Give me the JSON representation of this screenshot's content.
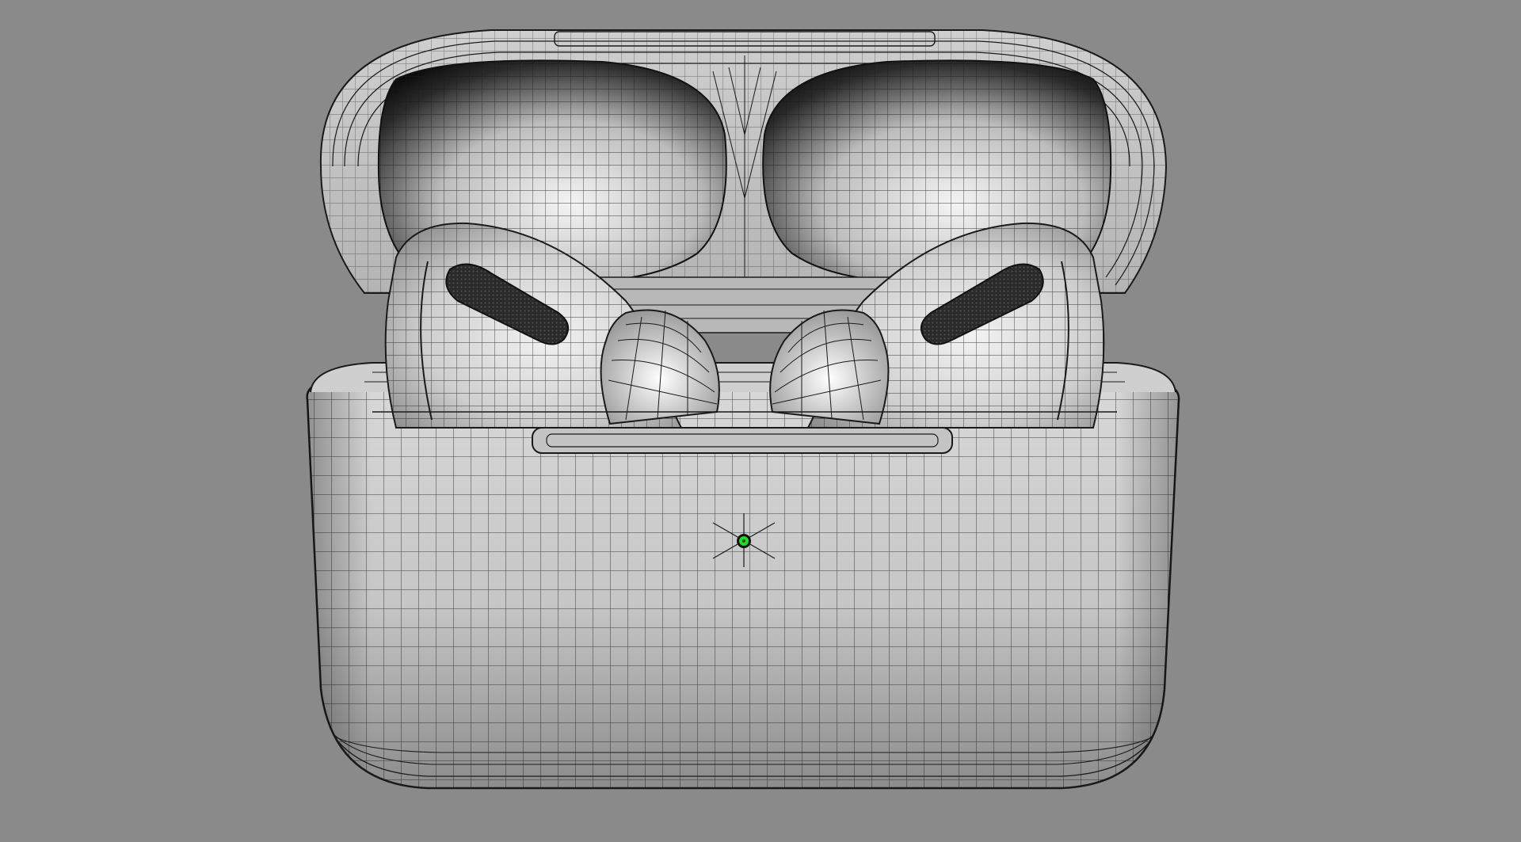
{
  "viewport": {
    "background_color": "#8a8a8a",
    "render_mode": "wireframe-on-shaded",
    "wire_color": "#1a1a1a",
    "surface_color": "#c8c8c8",
    "vertex_marker_color": "#2bd62b"
  },
  "scene": {
    "object": "earbuds-charging-case",
    "components": [
      "case-lid",
      "case-base",
      "earbud-left",
      "earbud-right",
      "status-light"
    ]
  }
}
